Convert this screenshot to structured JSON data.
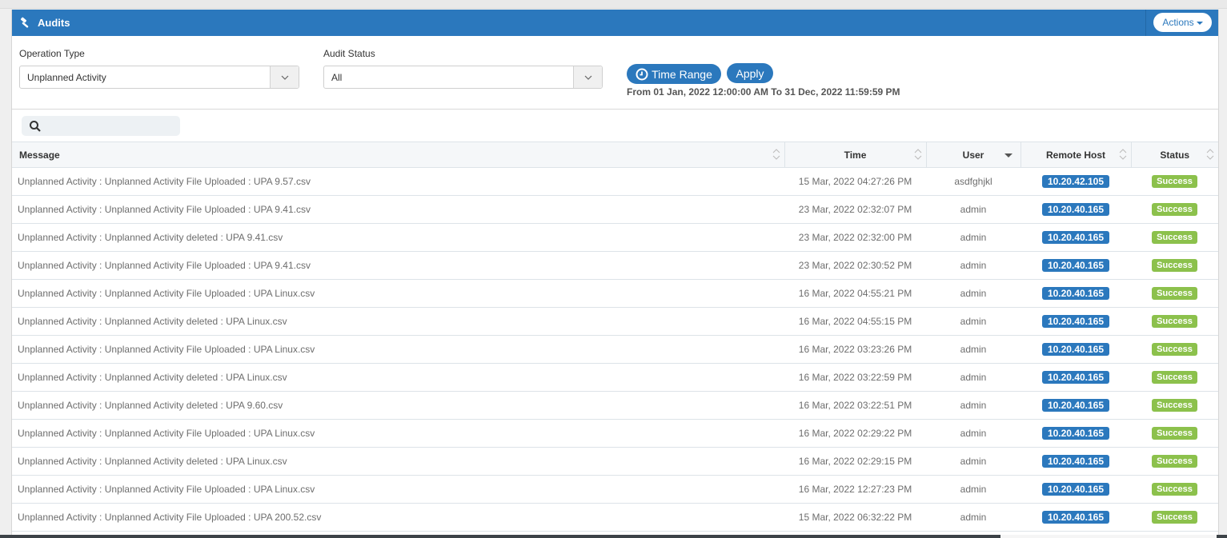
{
  "header": {
    "title": "Audits",
    "title_icon": "gavel-icon",
    "actions_label": "Actions"
  },
  "filters": {
    "operation_type": {
      "label": "Operation Type",
      "value": "Unplanned Activity"
    },
    "audit_status": {
      "label": "Audit Status",
      "value": "All"
    },
    "time_range_label": "Time Range",
    "apply_label": "Apply",
    "range_text": "From 01 Jan, 2022 12:00:00 AM To 31 Dec, 2022 11:59:59 PM"
  },
  "search": {
    "placeholder": "",
    "value": ""
  },
  "table": {
    "columns": [
      "Message",
      "Time",
      "User",
      "Remote Host",
      "Status"
    ],
    "rows": [
      {
        "message": "Unplanned Activity : Unplanned Activity File Uploaded : UPA 9.57.csv",
        "time": "15 Mar, 2022 04:27:26 PM",
        "user": "asdfghjkl",
        "host": "10.20.42.105",
        "status": "Success"
      },
      {
        "message": "Unplanned Activity : Unplanned Activity File Uploaded : UPA 9.41.csv",
        "time": "23 Mar, 2022 02:32:07 PM",
        "user": "admin",
        "host": "10.20.40.165",
        "status": "Success"
      },
      {
        "message": "Unplanned Activity : Unplanned Activity deleted : UPA 9.41.csv",
        "time": "23 Mar, 2022 02:32:00 PM",
        "user": "admin",
        "host": "10.20.40.165",
        "status": "Success"
      },
      {
        "message": "Unplanned Activity : Unplanned Activity File Uploaded : UPA 9.41.csv",
        "time": "23 Mar, 2022 02:30:52 PM",
        "user": "admin",
        "host": "10.20.40.165",
        "status": "Success"
      },
      {
        "message": "Unplanned Activity : Unplanned Activity File Uploaded : UPA Linux.csv",
        "time": "16 Mar, 2022 04:55:21 PM",
        "user": "admin",
        "host": "10.20.40.165",
        "status": "Success"
      },
      {
        "message": "Unplanned Activity : Unplanned Activity deleted : UPA Linux.csv",
        "time": "16 Mar, 2022 04:55:15 PM",
        "user": "admin",
        "host": "10.20.40.165",
        "status": "Success"
      },
      {
        "message": "Unplanned Activity : Unplanned Activity File Uploaded : UPA Linux.csv",
        "time": "16 Mar, 2022 03:23:26 PM",
        "user": "admin",
        "host": "10.20.40.165",
        "status": "Success"
      },
      {
        "message": "Unplanned Activity : Unplanned Activity deleted : UPA Linux.csv",
        "time": "16 Mar, 2022 03:22:59 PM",
        "user": "admin",
        "host": "10.20.40.165",
        "status": "Success"
      },
      {
        "message": "Unplanned Activity : Unplanned Activity deleted : UPA 9.60.csv",
        "time": "16 Mar, 2022 03:22:51 PM",
        "user": "admin",
        "host": "10.20.40.165",
        "status": "Success"
      },
      {
        "message": "Unplanned Activity : Unplanned Activity File Uploaded : UPA Linux.csv",
        "time": "16 Mar, 2022 02:29:22 PM",
        "user": "admin",
        "host": "10.20.40.165",
        "status": "Success"
      },
      {
        "message": "Unplanned Activity : Unplanned Activity deleted : UPA Linux.csv",
        "time": "16 Mar, 2022 02:29:15 PM",
        "user": "admin",
        "host": "10.20.40.165",
        "status": "Success"
      },
      {
        "message": "Unplanned Activity : Unplanned Activity File Uploaded : UPA Linux.csv",
        "time": "16 Mar, 2022 12:27:23 PM",
        "user": "admin",
        "host": "10.20.40.165",
        "status": "Success"
      },
      {
        "message": "Unplanned Activity : Unplanned Activity File Uploaded : UPA 200.52.csv",
        "time": "15 Mar, 2022 06:32:22 PM",
        "user": "admin",
        "host": "10.20.40.165",
        "status": "Success"
      }
    ]
  },
  "colors": {
    "brand": "#2b78bd",
    "success": "#8cc14c"
  }
}
